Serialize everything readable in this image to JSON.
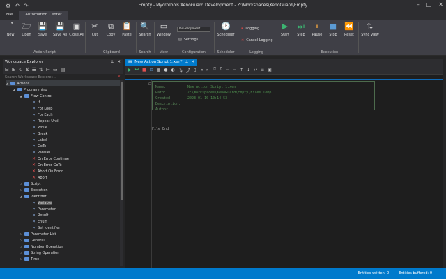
{
  "window": {
    "title": "Empty - MycroTools XenoGuard Development - Z:\\Workspaces\\XenoGuard\\Empty"
  },
  "menu_tabs": [
    "File",
    "Automation Center"
  ],
  "ribbon": {
    "groups": [
      {
        "label": "Action Script",
        "buttons": [
          "New",
          "Open",
          "Save",
          "Save All",
          "Close All"
        ]
      },
      {
        "label": "Clipboard",
        "buttons": [
          "Cut",
          "Copy",
          "Paste"
        ]
      },
      {
        "label": "Search",
        "buttons": [
          "Search"
        ]
      },
      {
        "label": "View",
        "buttons": [
          "Window"
        ]
      },
      {
        "label": "Configuration",
        "combo_value": "Development",
        "settings_label": "Settings"
      },
      {
        "label": "Scheduler",
        "buttons": [
          "Scheduler"
        ]
      },
      {
        "label": "Logging",
        "buttons": [
          "Logging",
          "Cancel Logging"
        ]
      },
      {
        "label": "Execution",
        "buttons": [
          "Start",
          "Step",
          "Pause",
          "Stop",
          "Reset"
        ]
      }
    ],
    "sync_view_label": "Sync View"
  },
  "explorer": {
    "title": "Workspace Explorer",
    "search_placeholder": "Search Workspace Explorer...",
    "tree": [
      {
        "label": "Actions",
        "level": 0,
        "type": "folder",
        "expanded": true,
        "selected": true
      },
      {
        "label": "Programming",
        "level": 1,
        "type": "folder",
        "expanded": true
      },
      {
        "label": "Flow Control",
        "level": 2,
        "type": "folder",
        "expanded": true
      },
      {
        "label": "If",
        "level": 3,
        "type": "keyword"
      },
      {
        "label": "For Loop",
        "level": 3,
        "type": "keyword"
      },
      {
        "label": "For Each",
        "level": 3,
        "type": "keyword"
      },
      {
        "label": "Repeat Until",
        "level": 3,
        "type": "keyword"
      },
      {
        "label": "While",
        "level": 3,
        "type": "keyword"
      },
      {
        "label": "Break",
        "level": 3,
        "type": "keyword"
      },
      {
        "label": "Label",
        "level": 3,
        "type": "keyword"
      },
      {
        "label": "GoTo",
        "level": 3,
        "type": "keyword"
      },
      {
        "label": "Parallel",
        "level": 3,
        "type": "keyword"
      },
      {
        "label": "On Error Continue",
        "level": 3,
        "type": "error"
      },
      {
        "label": "On Error GoTo",
        "level": 3,
        "type": "error"
      },
      {
        "label": "Abort On Error",
        "level": 3,
        "type": "error"
      },
      {
        "label": "Abort",
        "level": 3,
        "type": "error"
      },
      {
        "label": "Script",
        "level": 2,
        "type": "folder",
        "expanded": false
      },
      {
        "label": "Execution",
        "level": 2,
        "type": "folder",
        "expanded": false
      },
      {
        "label": "Identifier",
        "level": 2,
        "type": "folder",
        "expanded": true
      },
      {
        "label": "Variable",
        "level": 3,
        "type": "keyword",
        "hover": true
      },
      {
        "label": "Parameter",
        "level": 3,
        "type": "keyword"
      },
      {
        "label": "Result",
        "level": 3,
        "type": "keyword"
      },
      {
        "label": "Enum",
        "level": 3,
        "type": "keyword"
      },
      {
        "label": "Set Identifier",
        "level": 3,
        "type": "keyword"
      },
      {
        "label": "Parameter List",
        "level": 2,
        "type": "folder",
        "expanded": false
      },
      {
        "label": "General",
        "level": 2,
        "type": "folder",
        "expanded": false
      },
      {
        "label": "Number Operation",
        "level": 2,
        "type": "folder",
        "expanded": false
      },
      {
        "label": "String Operation",
        "level": 2,
        "type": "folder",
        "expanded": false
      },
      {
        "label": "Time",
        "level": 2,
        "type": "folder",
        "expanded": false
      }
    ]
  },
  "editor": {
    "tab_label": "New Action Script 1.xen*",
    "header": [
      {
        "key": "Name:",
        "value": "New Action Script 1.xen"
      },
      {
        "key": "Path:",
        "value": "Z:\\Workspaces\\XenoGuard\\Empty\\Files.Temp"
      },
      {
        "key": "Created:",
        "value": "2023-01-10 10:14:53"
      },
      {
        "key": "Description:",
        "value": ""
      },
      {
        "key": "Author:",
        "value": ""
      }
    ],
    "file_end": "File End"
  },
  "status": {
    "entities_written": "Entities written: 0",
    "entities_buffered": "Entities buffered: 0"
  }
}
